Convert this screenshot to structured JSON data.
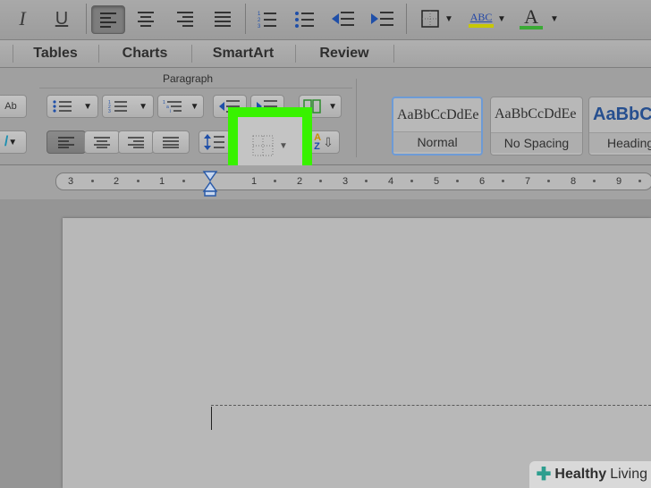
{
  "toolbar": {
    "italic_label": "I",
    "underline_label": "U",
    "spelling_label": "ABC",
    "font_color_label": "A",
    "colors": {
      "highlight_yellow": "#c8c800",
      "font_color_green": "#3aaa35"
    }
  },
  "tabs": [
    "Tables",
    "Charts",
    "SmartArt",
    "Review"
  ],
  "ribbon": {
    "group_title": "Paragraph",
    "styles": [
      {
        "preview": "AaBbCcDdEe",
        "name": "Normal"
      },
      {
        "preview": "AaBbCcDdEe",
        "name": "No Spacing"
      },
      {
        "preview": "AaBbCc",
        "name": "Heading"
      }
    ],
    "sort_label_a": "A",
    "sort_label_z": "Z",
    "ab_label": "Ab"
  },
  "ruler": {
    "labels": [
      "3",
      "2",
      "1",
      "1",
      "2",
      "3",
      "4",
      "5",
      "6",
      "7",
      "8",
      "9"
    ]
  },
  "highlight_color": "#38f200",
  "watermark": {
    "part1": "Healthy",
    "part2": "Living"
  }
}
